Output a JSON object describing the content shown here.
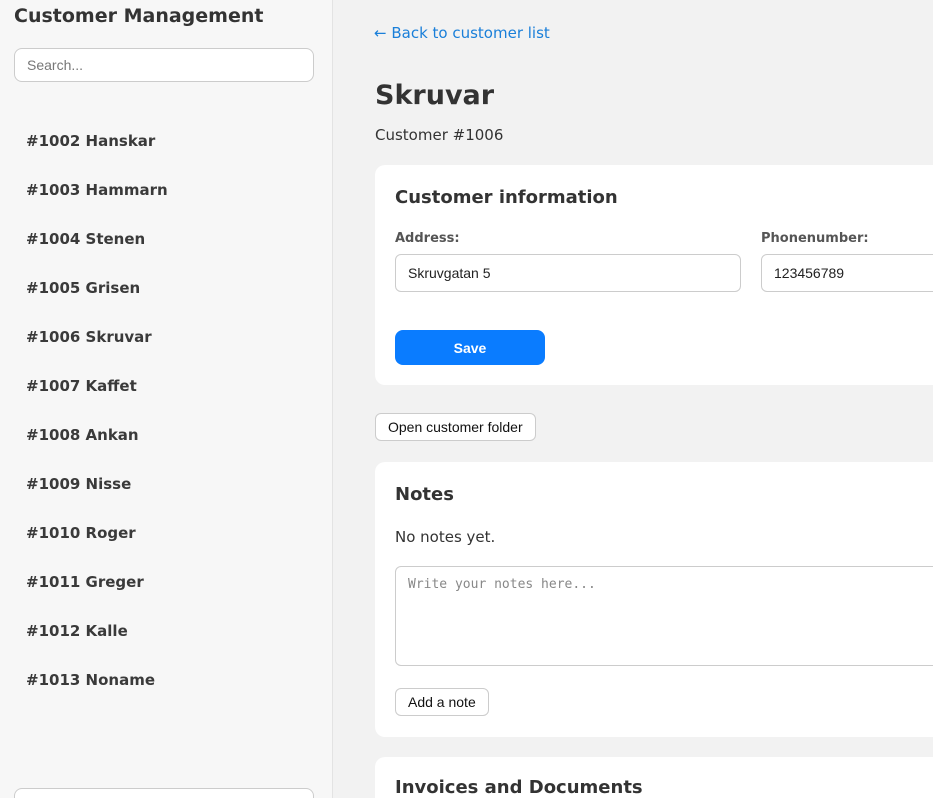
{
  "sidebar": {
    "title": "Customer Management",
    "search_placeholder": "Search...",
    "customers": [
      "#1002 Hanskar",
      "#1003 Hammarn",
      "#1004 Stenen",
      "#1005 Grisen",
      "#1006 Skruvar",
      "#1007 Kaffet",
      "#1008 Ankan",
      "#1009 Nisse",
      "#1010 Roger",
      "#1011 Greger",
      "#1012 Kalle",
      "#1013 Noname"
    ]
  },
  "main": {
    "back_link": "← Back to customer list",
    "title": "Skruvar",
    "subtitle": "Customer #1006",
    "info_card": {
      "title": "Customer information",
      "address_label": "Address:",
      "address_value": "Skruvgatan 5",
      "phone_label": "Phonenumber:",
      "phone_value": "123456789",
      "save_label": "Save"
    },
    "open_folder_label": "Open customer folder",
    "notes_card": {
      "title": "Notes",
      "empty_text": "No notes yet.",
      "textarea_placeholder": "Write your notes here...",
      "add_label": "Add a note"
    },
    "invoices_card": {
      "title": "Invoices and Documents"
    }
  },
  "colors": {
    "accent": "#0a7cff",
    "link": "#1a7fd9",
    "background": "#f2f2f2",
    "sidebar_background": "#f7f7f7",
    "card_background": "#ffffff"
  }
}
